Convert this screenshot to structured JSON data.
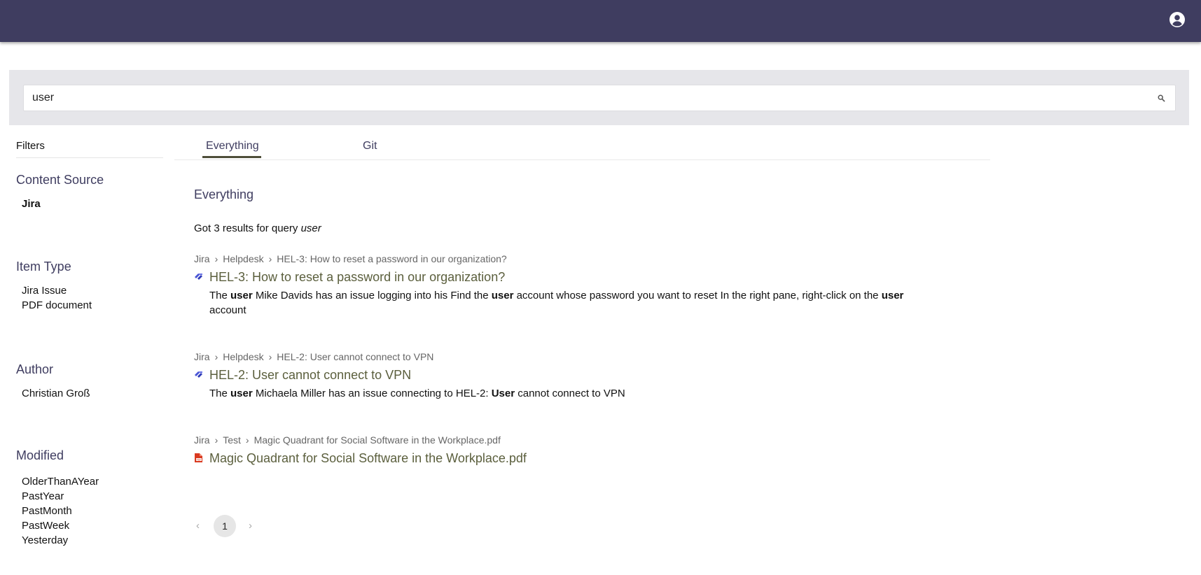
{
  "search": {
    "value": "user"
  },
  "sidebar": {
    "title": "Filters",
    "facets": [
      {
        "heading": "Content Source",
        "items": [
          "Jira"
        ]
      },
      {
        "heading": "Item Type",
        "items": [
          "Jira Issue",
          "PDF document"
        ]
      },
      {
        "heading": "Author",
        "items": [
          "Christian Groß"
        ]
      },
      {
        "heading": "Modified",
        "items": [
          "OlderThanAYear",
          "PastYear",
          "PastMonth",
          "PastWeek",
          "Yesterday"
        ]
      }
    ]
  },
  "tabs": [
    {
      "label": "Everything"
    },
    {
      "label": "Git"
    }
  ],
  "main": {
    "section_title": "Everything",
    "results_prefix": "Got 3 results for query ",
    "results_query": "user"
  },
  "results": [
    {
      "breadcrumb": [
        "Jira",
        "Helpdesk",
        "HEL-3: How to reset a password in our organization?"
      ],
      "title": "HEL-3: How to reset a password in our organization?",
      "icon": "jira-icon",
      "snippet": [
        {
          "t": "The ",
          "b": false
        },
        {
          "t": "user",
          "b": true
        },
        {
          "t": " Mike Davids has an issue logging into his Find the ",
          "b": false
        },
        {
          "t": "user",
          "b": true
        },
        {
          "t": " account whose password you want to reset In the right pane, right-click on the ",
          "b": false
        },
        {
          "t": "user",
          "b": true
        },
        {
          "t": " account",
          "b": false
        }
      ]
    },
    {
      "breadcrumb": [
        "Jira",
        "Helpdesk",
        "HEL-2: User cannot connect to VPN"
      ],
      "title": "HEL-2: User cannot connect to VPN",
      "icon": "jira-icon",
      "snippet": [
        {
          "t": "The ",
          "b": false
        },
        {
          "t": "user",
          "b": true
        },
        {
          "t": " Michaela Miller has an issue connecting to HEL-2: ",
          "b": false
        },
        {
          "t": "User",
          "b": true
        },
        {
          "t": " cannot connect to VPN",
          "b": false
        }
      ]
    },
    {
      "breadcrumb": [
        "Jira",
        "Test",
        "Magic Quadrant for Social Software in the Workplace.pdf"
      ],
      "title": "Magic Quadrant for Social Software in the Workplace.pdf",
      "icon": "pdf-icon",
      "snippet": []
    }
  ],
  "pagination": {
    "prev": "‹",
    "current": "1",
    "next": "›"
  },
  "colors": {
    "topbar": "#3f3d60",
    "heading": "#3f3d60",
    "result_title": "#5b5f3d",
    "jira_icon": "#4a55d6",
    "pdf_icon": "#d9391f"
  }
}
